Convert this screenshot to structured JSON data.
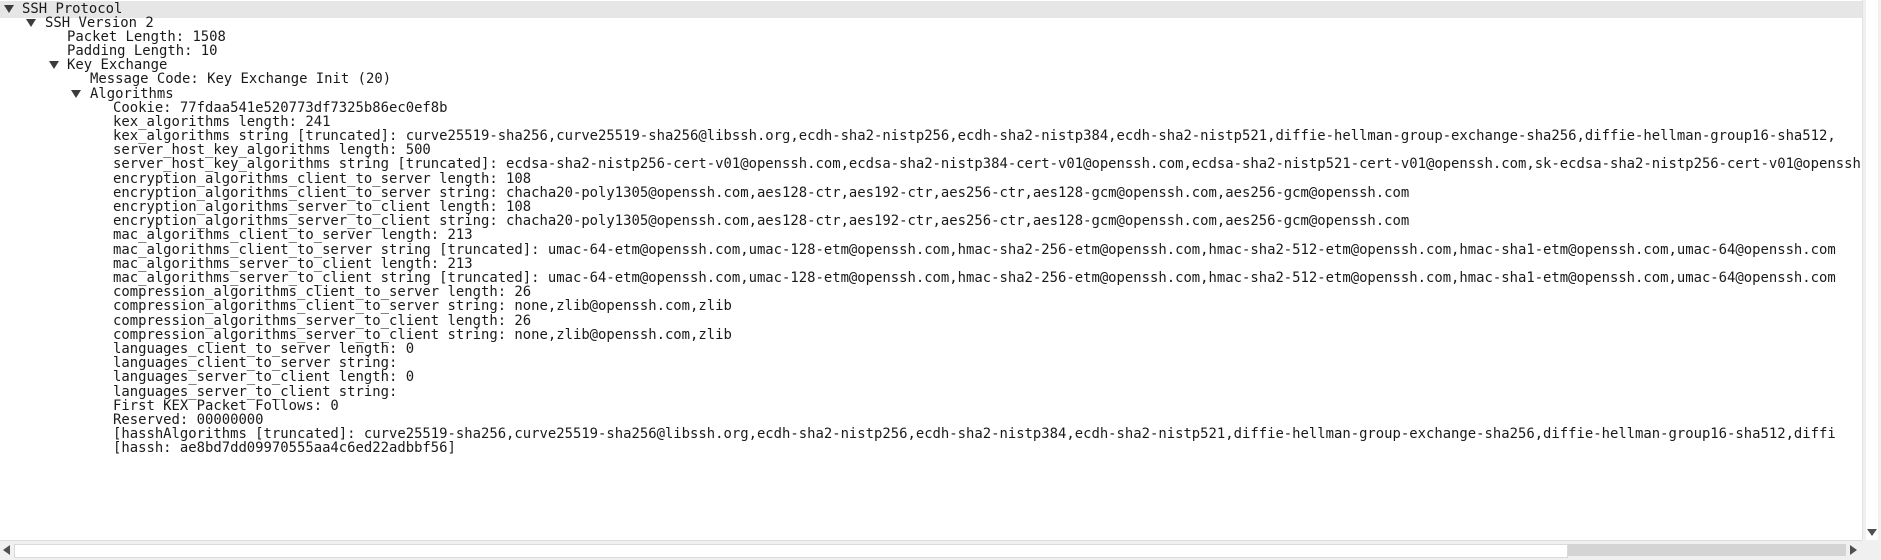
{
  "tree": {
    "cut_row": "                                                                            ",
    "ssh_protocol": "SSH Protocol",
    "ssh_version": "SSH Version 2",
    "packet_length": "Packet Length: 1508",
    "padding_length": "Padding Length: 10",
    "key_exchange": "Key Exchange",
    "message_code": "Message Code: Key Exchange Init (20)",
    "algorithms": "Algorithms",
    "fields": [
      "Cookie: 77fdaa541e520773df7325b86ec0ef8b",
      "kex_algorithms length: 241",
      "kex_algorithms string [truncated]: curve25519-sha256,curve25519-sha256@libssh.org,ecdh-sha2-nistp256,ecdh-sha2-nistp384,ecdh-sha2-nistp521,diffie-hellman-group-exchange-sha256,diffie-hellman-group16-sha512,",
      "server_host_key_algorithms length: 500",
      "server_host_key_algorithms string [truncated]: ecdsa-sha2-nistp256-cert-v01@openssh.com,ecdsa-sha2-nistp384-cert-v01@openssh.com,ecdsa-sha2-nistp521-cert-v01@openssh.com,sk-ecdsa-sha2-nistp256-cert-v01@openssh",
      "encryption_algorithms_client_to_server length: 108",
      "encryption_algorithms_client_to_server string: chacha20-poly1305@openssh.com,aes128-ctr,aes192-ctr,aes256-ctr,aes128-gcm@openssh.com,aes256-gcm@openssh.com",
      "encryption_algorithms_server_to_client length: 108",
      "encryption_algorithms_server_to_client string: chacha20-poly1305@openssh.com,aes128-ctr,aes192-ctr,aes256-ctr,aes128-gcm@openssh.com,aes256-gcm@openssh.com",
      "mac_algorithms_client_to_server length: 213",
      "mac_algorithms_client_to_server string [truncated]: umac-64-etm@openssh.com,umac-128-etm@openssh.com,hmac-sha2-256-etm@openssh.com,hmac-sha2-512-etm@openssh.com,hmac-sha1-etm@openssh.com,umac-64@openssh.com",
      "mac_algorithms_server_to_client length: 213",
      "mac_algorithms_server_to_client string [truncated]: umac-64-etm@openssh.com,umac-128-etm@openssh.com,hmac-sha2-256-etm@openssh.com,hmac-sha2-512-etm@openssh.com,hmac-sha1-etm@openssh.com,umac-64@openssh.com",
      "compression_algorithms_client_to_server length: 26",
      "compression_algorithms_client_to_server string: none,zlib@openssh.com,zlib",
      "compression_algorithms_server_to_client length: 26",
      "compression_algorithms_server_to_client string: none,zlib@openssh.com,zlib",
      "languages_client_to_server length: 0",
      "languages_client_to_server string:",
      "languages_server_to_client length: 0",
      "languages_server_to_client string:",
      "First KEX Packet Follows: 0",
      "Reserved: 00000000",
      "[hasshAlgorithms [truncated]: curve25519-sha256,curve25519-sha256@libssh.org,ecdh-sha2-nistp256,ecdh-sha2-nistp384,ecdh-sha2-nistp521,diffie-hellman-group-exchange-sha256,diffie-hellman-group16-sha512,diffi",
      "[hassh: ae8bd7dd09970555aa4c6ed22adbbf56]"
    ]
  },
  "colors": {
    "selected_row": "#e6e6e6",
    "text": "#1a1a1a",
    "scroll_track": "#f0f0f0"
  }
}
